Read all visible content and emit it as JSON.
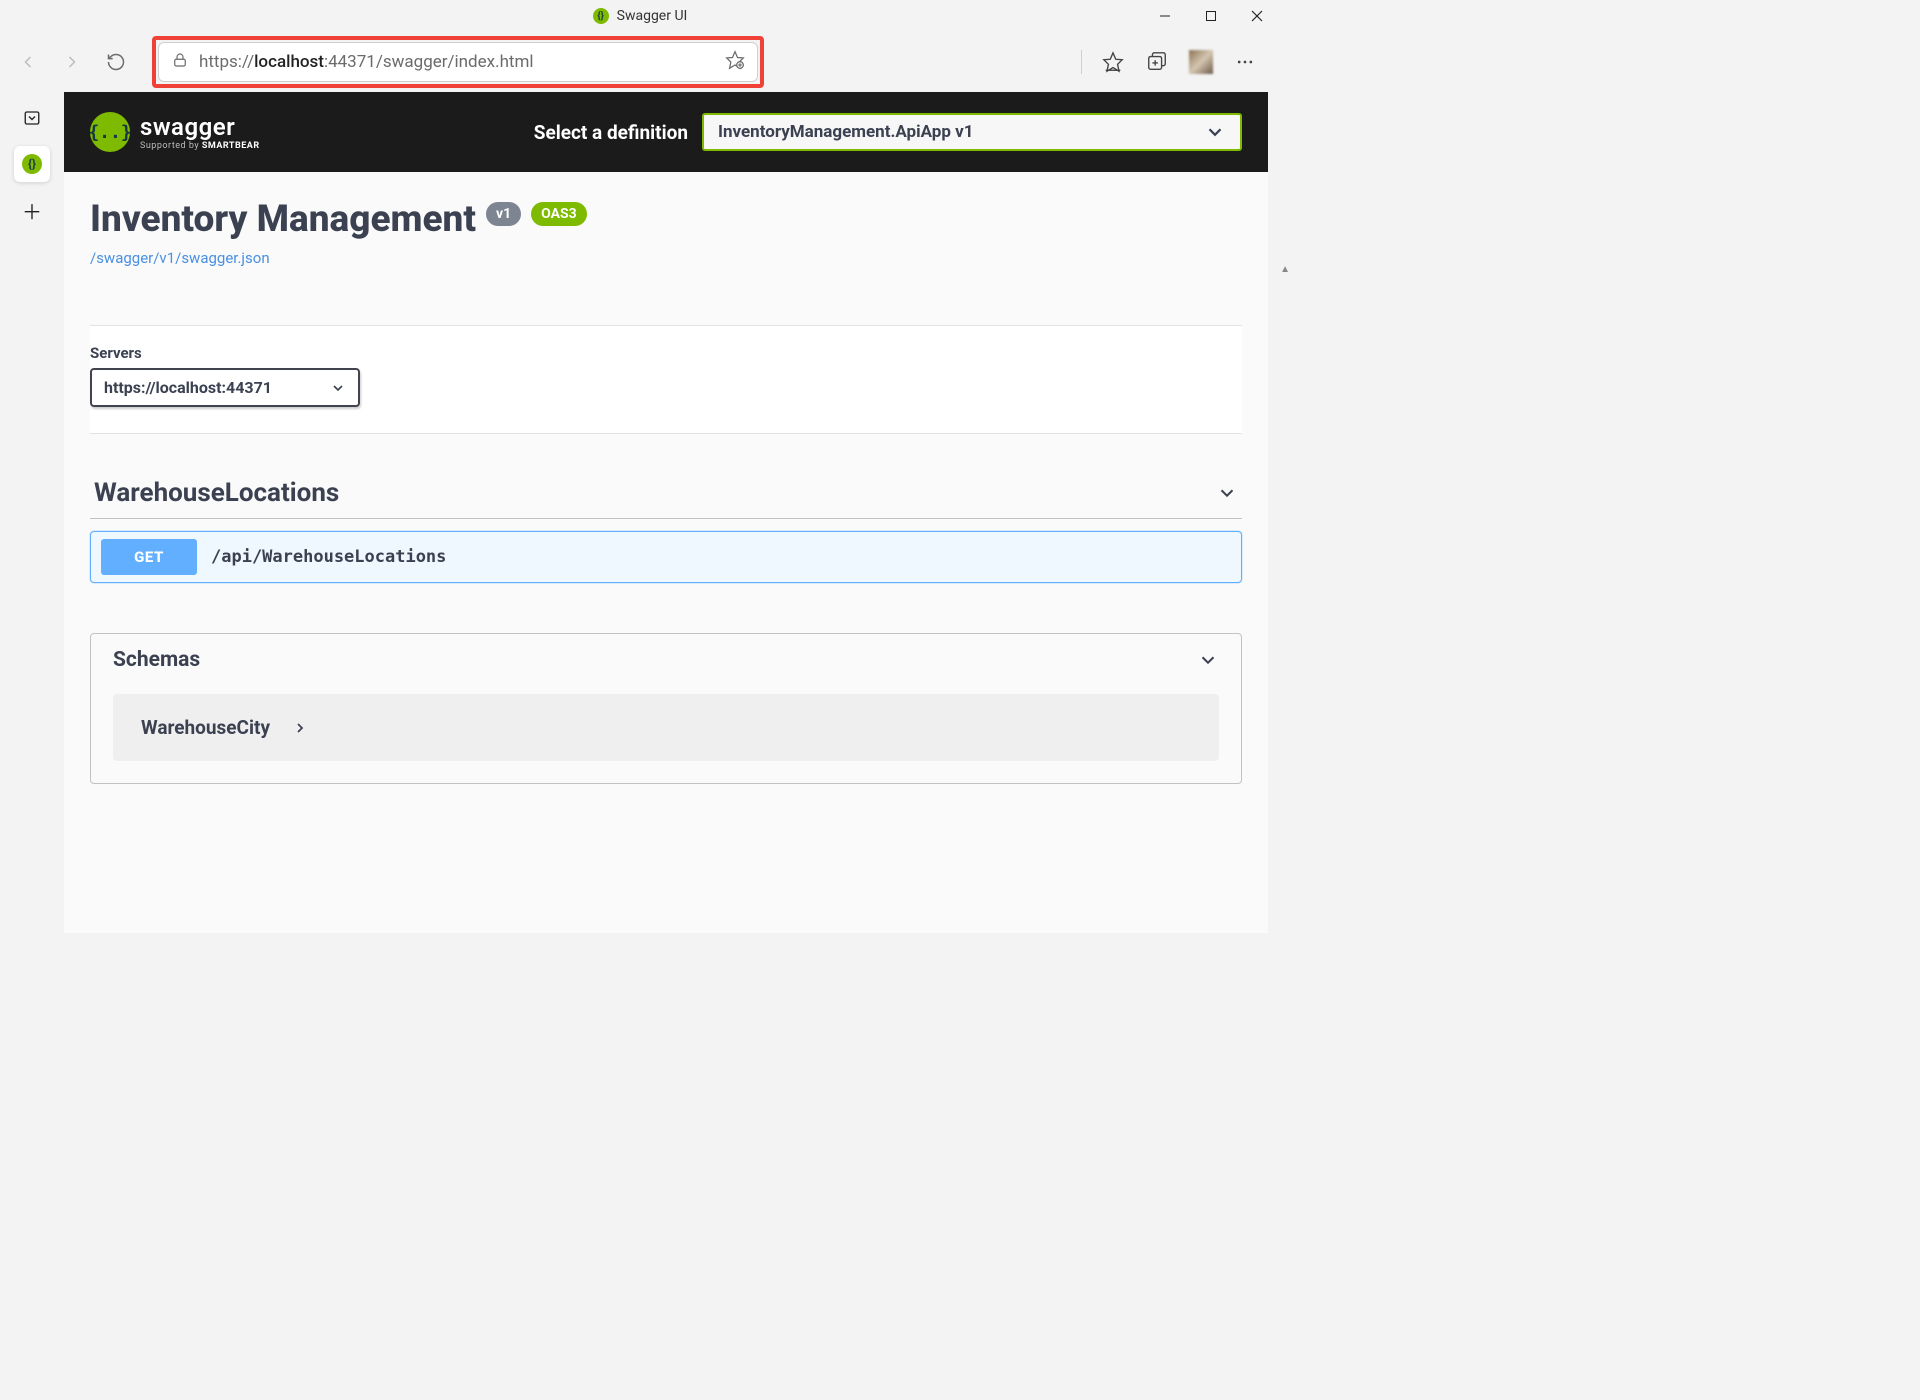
{
  "window": {
    "title": "Swagger UI"
  },
  "browser": {
    "url_scheme": "https://",
    "url_host": "localhost",
    "url_port_path": ":44371/swagger/index.html"
  },
  "swagger_header": {
    "brand": "swagger",
    "subtext_prefix": "Supported by ",
    "subtext_brand": "SMARTBEAR",
    "select_label": "Select a definition",
    "selected_def": "InventoryManagement.ApiApp v1"
  },
  "api": {
    "title": "Inventory Management",
    "version_badge": "v1",
    "oas_badge": "OAS3",
    "spec_link": "/swagger/v1/swagger.json"
  },
  "servers": {
    "label": "Servers",
    "selected": "https://localhost:44371"
  },
  "tag": {
    "name": "WarehouseLocations"
  },
  "operation": {
    "method": "GET",
    "path": "/api/WarehouseLocations"
  },
  "schemas": {
    "header": "Schemas",
    "items": [
      "WarehouseCity"
    ]
  }
}
